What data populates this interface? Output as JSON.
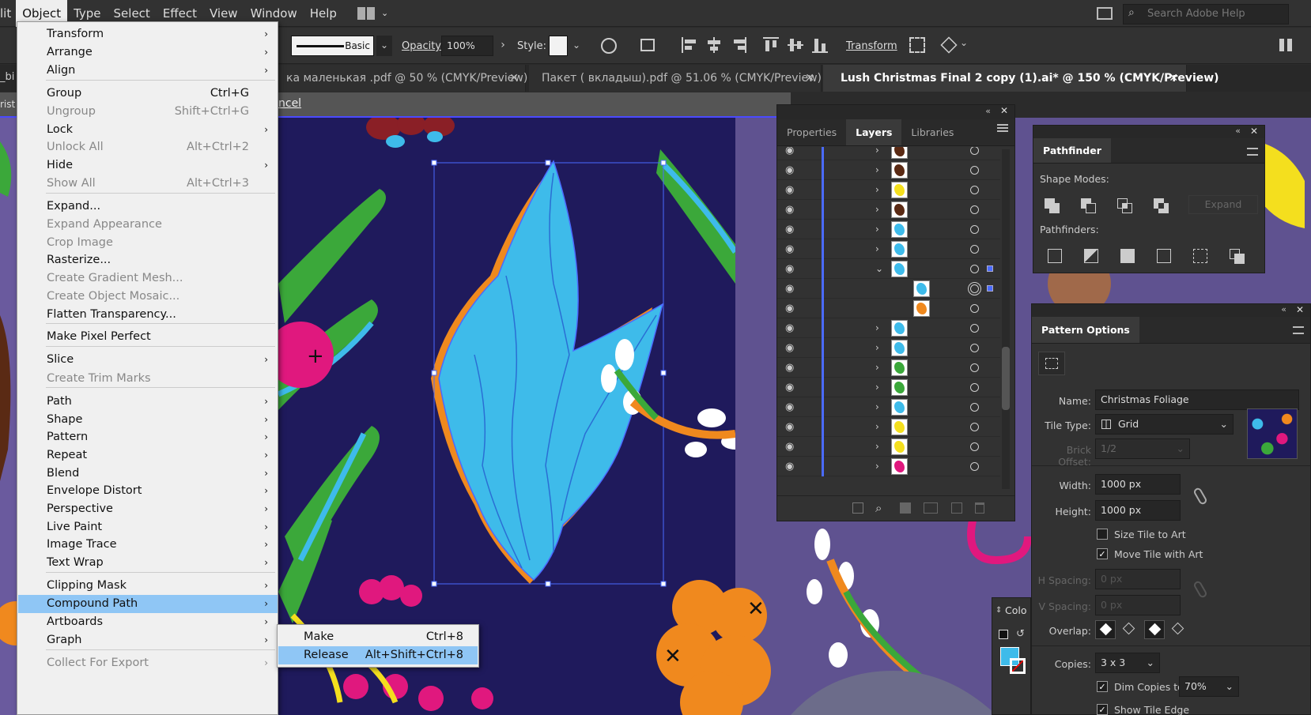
{
  "menubar": {
    "items": [
      "lit",
      "Object",
      "Type",
      "Select",
      "Effect",
      "View",
      "Window",
      "Help"
    ],
    "search_placeholder": "Search Adobe Help"
  },
  "controlbar": {
    "stroke_style": "Basic",
    "opacity_label": "Opacity:",
    "opacity_value": "100%",
    "style_label": "Style:",
    "transform_label": "Transform"
  },
  "tabs": [
    {
      "label": "ка маленькая .pdf @ 50 % (CMYK/Preview)",
      "active": false
    },
    {
      "label": "Пакет ( вкладыш).pdf @ 51.06 % (CMYK/Preview)",
      "active": false
    },
    {
      "label": "Lush Christmas Final 2 copy (1).ai* @ 150 % (CMYK/Preview)",
      "active": true
    }
  ],
  "isobar": {
    "cancel_label": "ncel",
    "left_label": "rist"
  },
  "object_menu": {
    "items": [
      {
        "label": "Transform",
        "shortcut": "",
        "submenu": true,
        "disabled": false
      },
      {
        "label": "Arrange",
        "shortcut": "",
        "submenu": true,
        "disabled": false
      },
      {
        "label": "Align",
        "shortcut": "",
        "submenu": true,
        "disabled": false
      },
      {
        "label": "Group",
        "shortcut": "Ctrl+G",
        "submenu": false,
        "disabled": false
      },
      {
        "label": "Ungroup",
        "shortcut": "Shift+Ctrl+G",
        "submenu": false,
        "disabled": true
      },
      {
        "label": "Lock",
        "shortcut": "",
        "submenu": true,
        "disabled": false
      },
      {
        "label": "Unlock All",
        "shortcut": "Alt+Ctrl+2",
        "submenu": false,
        "disabled": true
      },
      {
        "label": "Hide",
        "shortcut": "",
        "submenu": true,
        "disabled": false
      },
      {
        "label": "Show All",
        "shortcut": "Alt+Ctrl+3",
        "submenu": false,
        "disabled": true
      },
      {
        "label": "Expand...",
        "shortcut": "",
        "submenu": false,
        "disabled": false
      },
      {
        "label": "Expand Appearance",
        "shortcut": "",
        "submenu": false,
        "disabled": true
      },
      {
        "label": "Crop Image",
        "shortcut": "",
        "submenu": false,
        "disabled": true
      },
      {
        "label": "Rasterize...",
        "shortcut": "",
        "submenu": false,
        "disabled": false
      },
      {
        "label": "Create Gradient Mesh...",
        "shortcut": "",
        "submenu": false,
        "disabled": true
      },
      {
        "label": "Create Object Mosaic...",
        "shortcut": "",
        "submenu": false,
        "disabled": true
      },
      {
        "label": "Flatten Transparency...",
        "shortcut": "",
        "submenu": false,
        "disabled": false
      },
      {
        "label": "Make Pixel Perfect",
        "shortcut": "",
        "submenu": false,
        "disabled": false
      },
      {
        "label": "Slice",
        "shortcut": "",
        "submenu": true,
        "disabled": false
      },
      {
        "label": "Create Trim Marks",
        "shortcut": "",
        "submenu": false,
        "disabled": true
      },
      {
        "label": "Path",
        "shortcut": "",
        "submenu": true,
        "disabled": false
      },
      {
        "label": "Shape",
        "shortcut": "",
        "submenu": true,
        "disabled": false
      },
      {
        "label": "Pattern",
        "shortcut": "",
        "submenu": true,
        "disabled": false
      },
      {
        "label": "Repeat",
        "shortcut": "",
        "submenu": true,
        "disabled": false
      },
      {
        "label": "Blend",
        "shortcut": "",
        "submenu": true,
        "disabled": false
      },
      {
        "label": "Envelope Distort",
        "shortcut": "",
        "submenu": true,
        "disabled": false
      },
      {
        "label": "Perspective",
        "shortcut": "",
        "submenu": true,
        "disabled": false
      },
      {
        "label": "Live Paint",
        "shortcut": "",
        "submenu": true,
        "disabled": false
      },
      {
        "label": "Image Trace",
        "shortcut": "",
        "submenu": true,
        "disabled": false
      },
      {
        "label": "Text Wrap",
        "shortcut": "",
        "submenu": true,
        "disabled": false
      },
      {
        "label": "Clipping Mask",
        "shortcut": "",
        "submenu": true,
        "disabled": false
      },
      {
        "label": "Compound Path",
        "shortcut": "",
        "submenu": true,
        "disabled": false,
        "highlighted": true
      },
      {
        "label": "Artboards",
        "shortcut": "",
        "submenu": true,
        "disabled": false
      },
      {
        "label": "Graph",
        "shortcut": "",
        "submenu": true,
        "disabled": false
      },
      {
        "label": "Collect For Export",
        "shortcut": "",
        "submenu": true,
        "disabled": true
      }
    ]
  },
  "compound_submenu": {
    "items": [
      {
        "label": "Make",
        "shortcut": "Ctrl+8",
        "highlighted": false
      },
      {
        "label": "Release",
        "shortcut": "Alt+Shift+Ctrl+8",
        "highlighted": true
      }
    ]
  },
  "layers_panel": {
    "tabs": [
      "Properties",
      "Layers",
      "Libraries"
    ],
    "active_tab": "Layers"
  },
  "pathfinder_panel": {
    "title": "Pathfinder",
    "shape_modes_label": "Shape Modes:",
    "expand_label": "Expand",
    "pathfinders_label": "Pathfinders:"
  },
  "pattern_options": {
    "title": "Pattern Options",
    "name_label": "Name:",
    "name_value": "Christmas Foliage",
    "tile_type_label": "Tile Type:",
    "tile_type_value": "Grid",
    "brick_offset_label": "Brick Offset:",
    "brick_offset_value": "1/2",
    "width_label": "Width:",
    "width_value": "1000 px",
    "height_label": "Height:",
    "height_value": "1000 px",
    "size_tile_label": "Size Tile to Art",
    "move_tile_label": "Move Tile with Art",
    "h_spacing_label": "H Spacing:",
    "h_spacing_value": "0 px",
    "v_spacing_label": "V Spacing:",
    "v_spacing_value": "0 px",
    "overlap_label": "Overlap:",
    "copies_label": "Copies:",
    "copies_value": "3 x 3",
    "dim_copies_label": "Dim Copies to:",
    "dim_copies_value": "70%",
    "show_tile_edge_label": "Show Tile Edge"
  },
  "color_panel": {
    "label": "Colo"
  },
  "colors": {
    "accent_highlight": "#8fc6f5",
    "artboard_bg": "#1f1a5c",
    "leaf_blue": "#3ebbea",
    "leaf_green": "#3ba83a",
    "berry_pink": "#e0187e",
    "orange": "#f0891e",
    "selection": "#4a6bff"
  }
}
